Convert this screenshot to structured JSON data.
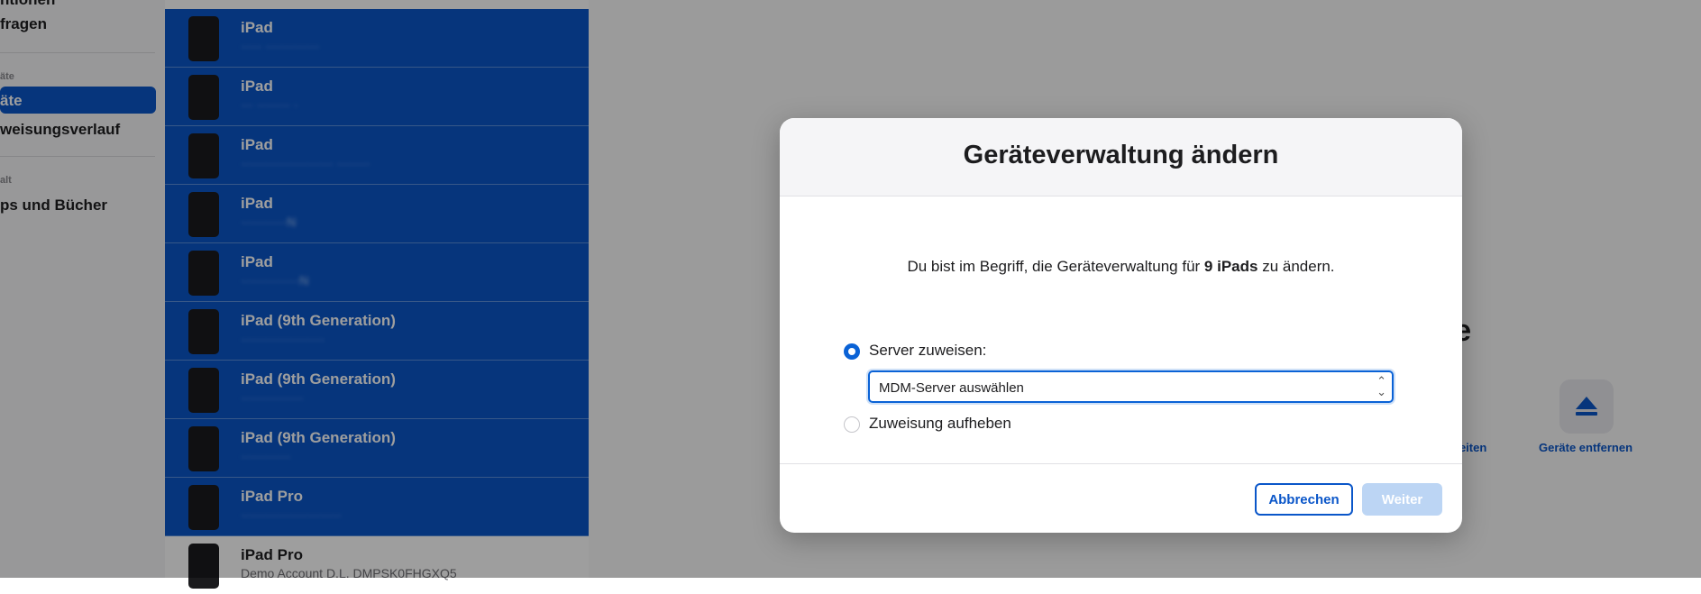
{
  "sidebar": {
    "items": [
      {
        "label": "ntionen"
      },
      {
        "label": "fragen"
      },
      {
        "label": "äte"
      },
      {
        "label": "äte"
      },
      {
        "label": "weisungsverlauf"
      },
      {
        "label": "alt"
      },
      {
        "label": "ps und Bücher"
      }
    ]
  },
  "devices": [
    {
      "title": "iPad",
      "subtitle": "····· ·············"
    },
    {
      "title": "iPad",
      "subtitle": "··· ········ ·"
    },
    {
      "title": "iPad",
      "subtitle": "······················ ········"
    },
    {
      "title": "iPad",
      "subtitle": "···········N"
    },
    {
      "title": "iPad",
      "subtitle": "··············N"
    },
    {
      "title": "iPad (9th Generation)",
      "subtitle": "····················"
    },
    {
      "title": "iPad (9th Generation)",
      "subtitle": "···············"
    },
    {
      "title": "iPad (9th Generation)",
      "subtitle": "············"
    },
    {
      "title": "iPad Pro",
      "subtitle": "························"
    },
    {
      "title": "iPad Pro",
      "subtitle": "Demo Account D.L. DMPSK0FHGXQ5"
    }
  ],
  "detail": {
    "title_fragment": "äte",
    "action_edit_fragment": "beiten",
    "action_remove_label": "Geräte entfernen"
  },
  "modal": {
    "title": "Geräteverwaltung ändern",
    "text_before": "Du bist im Begriff, die Geräteverwaltung für ",
    "text_bold": "9 iPads",
    "text_after": " zu ändern.",
    "option_assign": "Server zuweisen:",
    "option_unassign": "Zuweisung aufheben",
    "select_value": "MDM-Server auswählen",
    "cancel_label": "Abbrechen",
    "next_label": "Weiter"
  },
  "colors": {
    "accent": "#0a56c9",
    "disabled_button": "#bcd5f4"
  }
}
